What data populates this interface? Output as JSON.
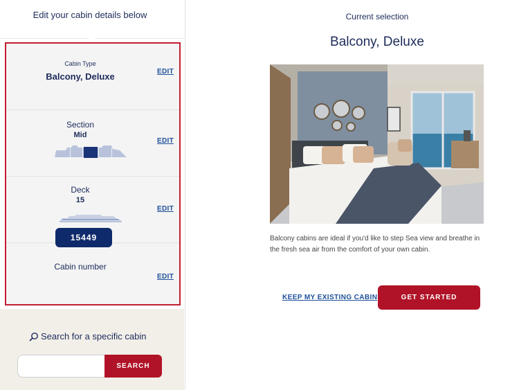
{
  "left_panel": {
    "title": "Edit your cabin details below",
    "cards": {
      "cabin_type": {
        "label": "Cabin Type",
        "value": "Balcony, Deluxe",
        "edit_label": "EDIT"
      },
      "section": {
        "label": "Section",
        "value": "Mid",
        "edit_label": "EDIT"
      },
      "deck": {
        "label": "Deck",
        "value": "15",
        "edit_label": "EDIT"
      },
      "cabin_number": {
        "label": "Cabin number",
        "value": "15449",
        "edit_label": "EDIT"
      }
    },
    "search": {
      "label": "Search for a specific cabin",
      "input_value": "",
      "button_label": "SEARCH"
    }
  },
  "right_panel": {
    "current_label": "Current selection",
    "title": "Balcony, Deluxe",
    "description": "Balcony cabins are ideal if you'd like to step Sea view and breathe in the fresh sea air from the comfort of your own cabin.",
    "keep_link": "KEEP MY EXISTING CABIN",
    "start_button": "GET STARTED"
  },
  "colors": {
    "navy": "#1d2b5a",
    "accent_red": "#b01327",
    "link_blue": "#1d4f9a",
    "highlight_border": "#c01d2e",
    "pill_navy": "#0f2a6b"
  },
  "icons": [
    "search-icon",
    "ship-section-icon",
    "ship-deck-icon"
  ]
}
